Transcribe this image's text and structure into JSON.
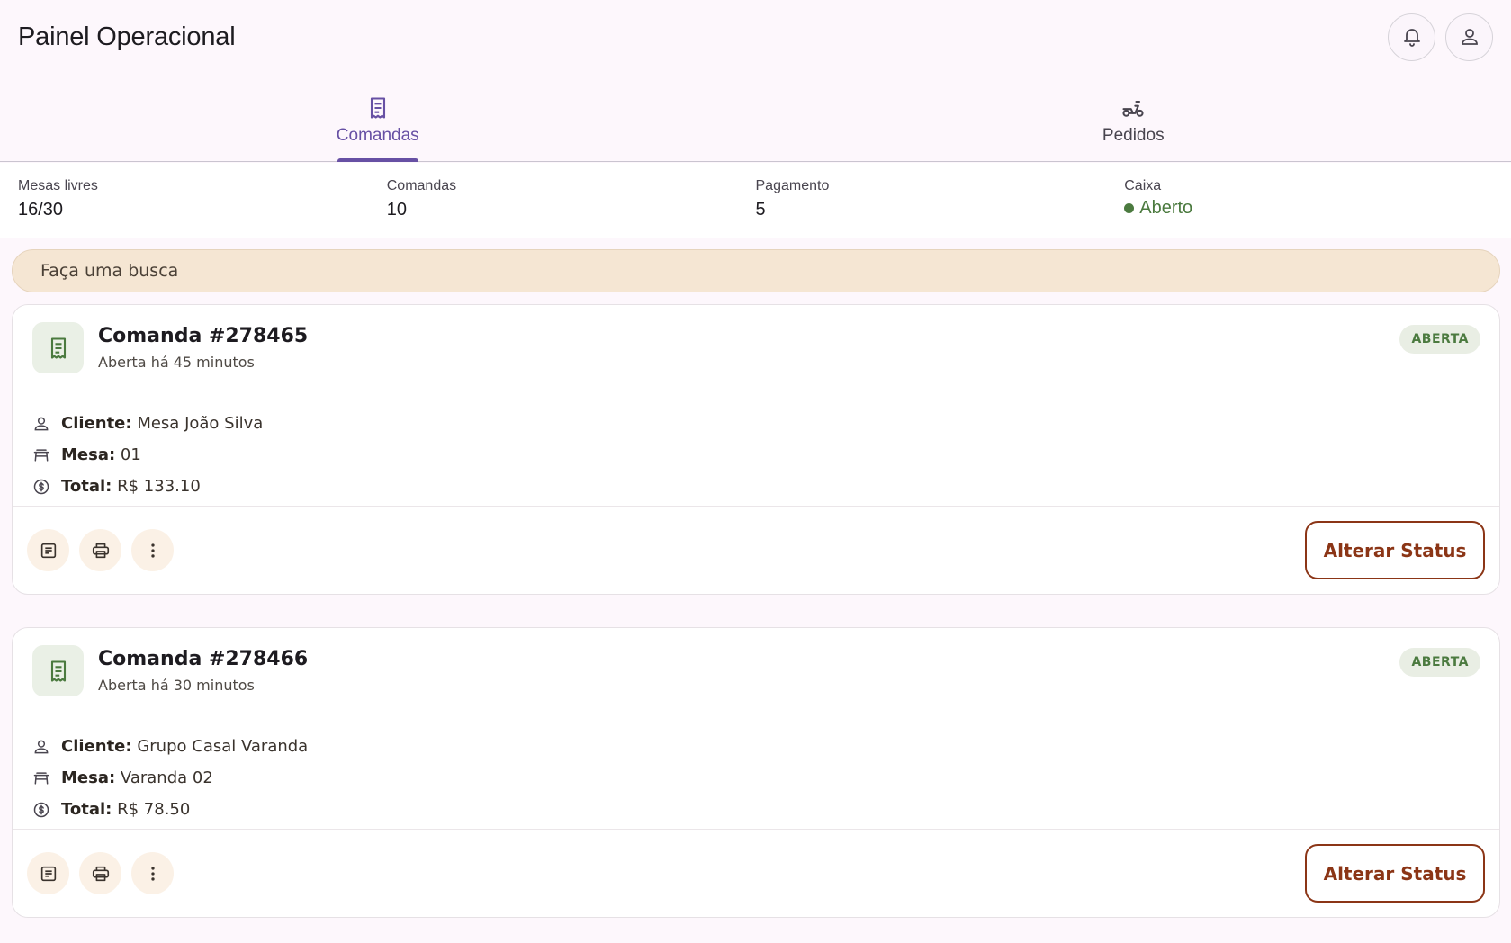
{
  "header": {
    "title": "Painel Operacional",
    "notifications_icon": "bell-icon",
    "profile_icon": "person-icon"
  },
  "tabs": [
    {
      "label": "Comandas",
      "icon": "receipt-icon",
      "active": true
    },
    {
      "label": "Pedidos",
      "icon": "scooter-icon",
      "active": false
    }
  ],
  "stats": {
    "free_tables": {
      "label": "Mesas livres",
      "value": "16/30"
    },
    "orders": {
      "label": "Comandas",
      "value": "10"
    },
    "payment": {
      "label": "Pagamento",
      "value": "5"
    },
    "register": {
      "label": "Caixa",
      "value": "Aberto",
      "color": "#4b7a3f"
    }
  },
  "search": {
    "placeholder": "Faça uma busca"
  },
  "cards": [
    {
      "title": "Comanda #278465",
      "subtitle": "Aberta há 45 minutos",
      "badge": "ABERTA",
      "client_label": "Cliente:",
      "client": "Mesa João Silva",
      "table_label": "Mesa:",
      "table": "01",
      "total_label": "Total:",
      "total": "R$ 133.10",
      "status_button": "Alterar Status"
    },
    {
      "title": "Comanda #278466",
      "subtitle": "Aberta há 30 minutos",
      "badge": "ABERTA",
      "client_label": "Cliente:",
      "client": "Grupo Casal Varanda",
      "table_label": "Mesa:",
      "table": "Varanda 02",
      "total_label": "Total:",
      "total": "R$ 78.50",
      "status_button": "Alterar Status"
    }
  ],
  "colors": {
    "primary": "#6750a4",
    "accent": "#8b3516",
    "success": "#4b7a3f",
    "search_bg": "#f5e6d3"
  }
}
